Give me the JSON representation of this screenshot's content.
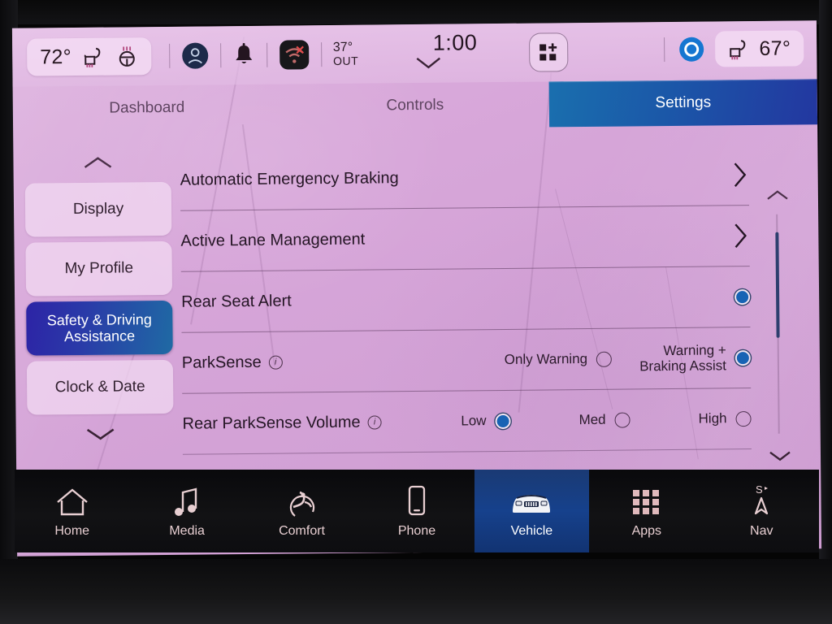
{
  "statusbar": {
    "cabin_temp": "72°",
    "heated_seat_left_icon": "heated-seat-icon",
    "heated_steering_icon": "heated-steering-wheel-icon",
    "profile_icon": "user-profile-icon",
    "notification_icon": "bell-icon",
    "wifi_icon": "wifi-disconnected-icon",
    "outside_temp": "37°",
    "outside_label": "OUT",
    "clock": "1:00",
    "clock_chevron_icon": "chevron-down-icon",
    "widget_icon": "add-widget-icon",
    "assistant_icon": "assistant-circle-icon",
    "passenger_seat_icon": "heated-seat-icon",
    "passenger_temp": "67°"
  },
  "tabs": [
    {
      "label": "Dashboard",
      "active": false
    },
    {
      "label": "Controls",
      "active": false
    },
    {
      "label": "Settings",
      "active": true
    }
  ],
  "sidebar": {
    "up_icon": "chevron-up-icon",
    "down_icon": "chevron-down-icon",
    "items": [
      {
        "label": "Display",
        "selected": false
      },
      {
        "label": "My Profile",
        "selected": false
      },
      {
        "label": "Safety & Driving Assistance",
        "selected": true
      },
      {
        "label": "Clock & Date",
        "selected": false
      }
    ]
  },
  "settings_rows": [
    {
      "label": "Automatic Emergency Braking",
      "type": "navigate",
      "info": false,
      "chevron_icon": "chevron-right-icon"
    },
    {
      "label": "Active Lane Management",
      "type": "navigate",
      "info": false,
      "chevron_icon": "chevron-right-icon"
    },
    {
      "label": "Rear Seat Alert",
      "type": "toggle",
      "info": false,
      "options": [
        {
          "label": "",
          "selected": true
        }
      ]
    },
    {
      "label": "ParkSense",
      "type": "radio",
      "info": true,
      "options": [
        {
          "label": "Only Warning",
          "selected": false
        },
        {
          "label": "Warning +\nBraking Assist",
          "selected": true
        }
      ]
    },
    {
      "label": "Rear ParkSense Volume",
      "type": "radio",
      "info": true,
      "options": [
        {
          "label": "Low",
          "selected": true
        },
        {
          "label": "Med",
          "selected": false
        },
        {
          "label": "High",
          "selected": false
        }
      ]
    }
  ],
  "scrollbar": {
    "up_icon": "chevron-up-icon",
    "down_icon": "chevron-down-icon"
  },
  "bottom_nav": [
    {
      "label": "Home",
      "icon": "home-icon",
      "active": false
    },
    {
      "label": "Media",
      "icon": "music-note-icon",
      "active": false
    },
    {
      "label": "Comfort",
      "icon": "comfort-seat-icon",
      "active": false
    },
    {
      "label": "Phone",
      "icon": "phone-icon",
      "active": false
    },
    {
      "label": "Vehicle",
      "icon": "vehicle-front-icon",
      "active": true
    },
    {
      "label": "Apps",
      "icon": "apps-grid-icon",
      "active": false
    },
    {
      "label": "Nav",
      "icon": "compass-needle-icon",
      "active": false
    }
  ],
  "colors": {
    "panel_bg": "#d7a6d9",
    "accent_blue": "#1763b4",
    "tab_active_from": "#1a6fae",
    "tab_active_to": "#2337a0",
    "sidebar_sel_from": "#2c23a6",
    "sidebar_sel_to": "#1f6aa4",
    "text_dark": "#241524",
    "nav_icon": "#e8cfd2"
  }
}
